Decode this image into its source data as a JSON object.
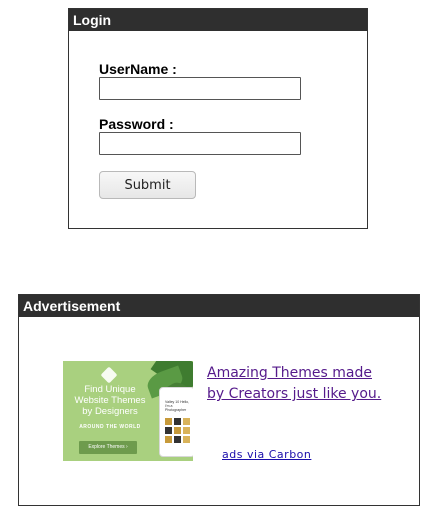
{
  "login": {
    "title": "Login",
    "username_label": "UserName :",
    "username_value": "",
    "password_label": "Password :",
    "password_value": "",
    "submit_label": "Submit"
  },
  "advertisement": {
    "title": "Advertisement",
    "image": {
      "headline_line1": "Find Unique",
      "headline_line2": "Website Themes",
      "headline_line3": "by Designers",
      "subline": "AROUND THE WORLD",
      "button_label": "Explore Themes ›",
      "tablet_caption": "Valley 10 Hello, I'm a Photographer",
      "background_color": "#a9d07f"
    },
    "link_line1": "Amazing Themes made",
    "link_line2": "by Creators just like you.",
    "carbon_label": "ads via Carbon",
    "link_color": "#551a8b"
  }
}
